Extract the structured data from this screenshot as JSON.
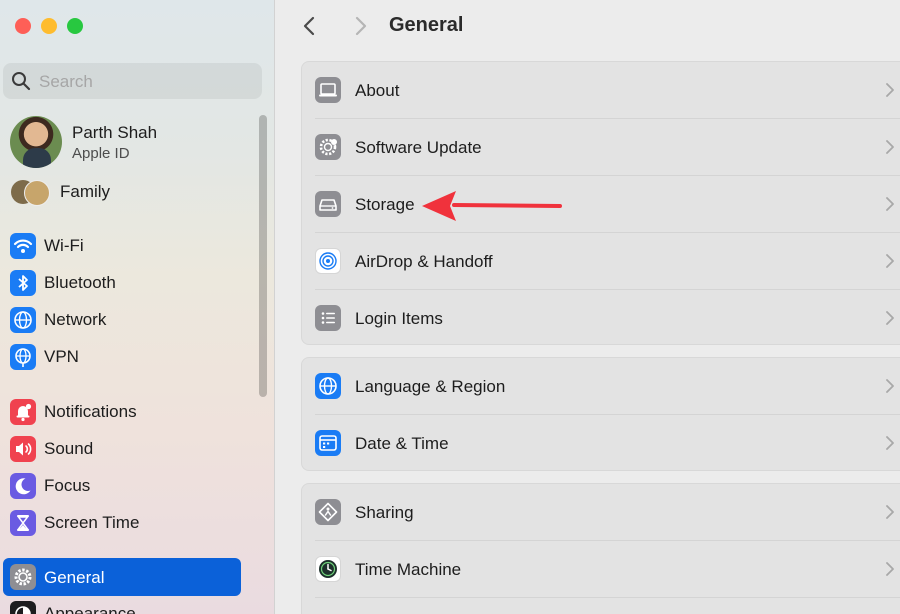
{
  "window": {
    "title": "General"
  },
  "search": {
    "placeholder": "Search"
  },
  "profile": {
    "name": "Parth Shah",
    "subtitle": "Apple ID"
  },
  "family": {
    "label": "Family"
  },
  "sidebar": {
    "items": [
      {
        "label": "Wi-Fi",
        "icon": "wifi-icon",
        "color": "#1a7cf5"
      },
      {
        "label": "Bluetooth",
        "icon": "bluetooth-icon",
        "color": "#1a7cf5"
      },
      {
        "label": "Network",
        "icon": "globe-icon",
        "color": "#1a7cf5"
      },
      {
        "label": "VPN",
        "icon": "vpn-globe-icon",
        "color": "#1a7cf5"
      },
      {
        "label": "Notifications",
        "icon": "bell-icon",
        "color": "#f0424f"
      },
      {
        "label": "Sound",
        "icon": "speaker-icon",
        "color": "#f0424f"
      },
      {
        "label": "Focus",
        "icon": "moon-icon",
        "color": "#6a5be2"
      },
      {
        "label": "Screen Time",
        "icon": "hourglass-icon",
        "color": "#6a5be2"
      },
      {
        "label": "General",
        "icon": "gear-icon",
        "color": "#8e8e93",
        "selected": true
      },
      {
        "label": "Appearance",
        "icon": "appearance-icon",
        "color": "#1d1d1f"
      }
    ]
  },
  "main": {
    "groups": [
      {
        "rows": [
          {
            "label": "About",
            "icon": "laptop-icon",
            "color": "#8e8e93"
          },
          {
            "label": "Software Update",
            "icon": "gear-badge-icon",
            "color": "#8e8e93"
          },
          {
            "label": "Storage",
            "icon": "drive-icon",
            "color": "#8e8e93"
          },
          {
            "label": "AirDrop & Handoff",
            "icon": "airdrop-icon",
            "color": "#ffffff"
          },
          {
            "label": "Login Items",
            "icon": "list-icon",
            "color": "#8e8e93"
          }
        ]
      },
      {
        "rows": [
          {
            "label": "Language & Region",
            "icon": "globe-icon",
            "color": "#1a7cf5"
          },
          {
            "label": "Date & Time",
            "icon": "calendar-clock-icon",
            "color": "#1a7cf5"
          }
        ]
      },
      {
        "rows": [
          {
            "label": "Sharing",
            "icon": "sharing-icon",
            "color": "#8e8e93"
          },
          {
            "label": "Time Machine",
            "icon": "time-machine-icon",
            "color": "#8e8e93"
          }
        ]
      }
    ]
  },
  "annotation": {
    "color": "#f0323c"
  }
}
